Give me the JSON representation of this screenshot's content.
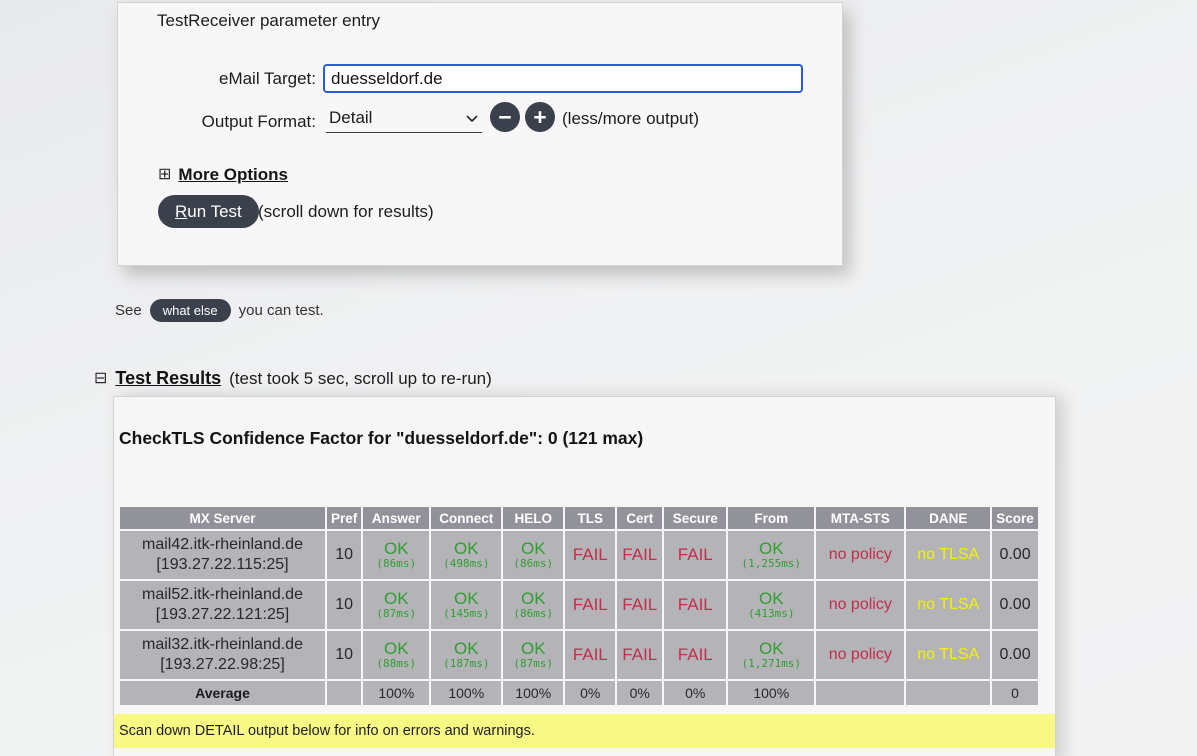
{
  "form": {
    "title": "TestReceiver parameter entry",
    "email_label": "eMail Target:",
    "email_value": "duesseldorf.de",
    "output_label": "Output Format:",
    "output_value": "Detail",
    "less_more_hint": "(less/more output)",
    "minus_glyph": "−",
    "plus_glyph": "+",
    "more_options_glyph": "⊞",
    "more_options_label": "More Options",
    "run_test_key": "R",
    "run_test_rest": "un Test",
    "run_hint": "(scroll down for results)"
  },
  "see_line": {
    "prefix": "See",
    "button_label": "what else",
    "suffix": "you can test."
  },
  "results_header": {
    "glyph": "⊟",
    "title": "Test Results",
    "note": "(test took 5 sec, scroll up to re-run)"
  },
  "results": {
    "confidence_title": "CheckTLS Confidence Factor for \"duesseldorf.de\": 0 (121 max)",
    "banner": "Scan down DETAIL output below for info on errors and warnings.",
    "table": {
      "columns": [
        "MX Server",
        "Pref",
        "Answer",
        "Connect",
        "HELO",
        "TLS",
        "Cert",
        "Secure",
        "From",
        "MTA-STS",
        "DANE",
        "Score"
      ],
      "rows": [
        {
          "host": "mail42.itk-rheinland.de",
          "addr": "[193.27.22.115:25]",
          "pref": "10",
          "answer": {
            "status": "OK",
            "ms": "(86ms)"
          },
          "connect": {
            "status": "OK",
            "ms": "(498ms)"
          },
          "helo": {
            "status": "OK",
            "ms": "(86ms)"
          },
          "tls": "FAIL",
          "cert": "FAIL",
          "secure": "FAIL",
          "from": {
            "status": "OK",
            "ms": "(1,255ms)"
          },
          "mta_sts": "no policy",
          "dane": "no TLSA",
          "score": "0.00"
        },
        {
          "host": "mail52.itk-rheinland.de",
          "addr": "[193.27.22.121:25]",
          "pref": "10",
          "answer": {
            "status": "OK",
            "ms": "(87ms)"
          },
          "connect": {
            "status": "OK",
            "ms": "(145ms)"
          },
          "helo": {
            "status": "OK",
            "ms": "(86ms)"
          },
          "tls": "FAIL",
          "cert": "FAIL",
          "secure": "FAIL",
          "from": {
            "status": "OK",
            "ms": "(413ms)"
          },
          "mta_sts": "no policy",
          "dane": "no TLSA",
          "score": "0.00"
        },
        {
          "host": "mail32.itk-rheinland.de",
          "addr": "[193.27.22.98:25]",
          "pref": "10",
          "answer": {
            "status": "OK",
            "ms": "(88ms)"
          },
          "connect": {
            "status": "OK",
            "ms": "(187ms)"
          },
          "helo": {
            "status": "OK",
            "ms": "(87ms)"
          },
          "tls": "FAIL",
          "cert": "FAIL",
          "secure": "FAIL",
          "from": {
            "status": "OK",
            "ms": "(1,271ms)"
          },
          "mta_sts": "no policy",
          "dane": "no TLSA",
          "score": "0.00"
        }
      ],
      "average": [
        "Average",
        "",
        "100%",
        "100%",
        "100%",
        "0%",
        "0%",
        "0%",
        "100%",
        "",
        "",
        "0"
      ]
    }
  },
  "colors": {
    "input_focus_border": "#2E5CD8",
    "dark_button": "#3B404D",
    "ok_green": "#2F9E2F",
    "fail_red": "#C22E4A",
    "dane_yellow": "#F2F200",
    "banner_yellow": "#F8F885",
    "table_header_bg": "#92929A",
    "table_cell_bg": "#B4B4B8"
  }
}
